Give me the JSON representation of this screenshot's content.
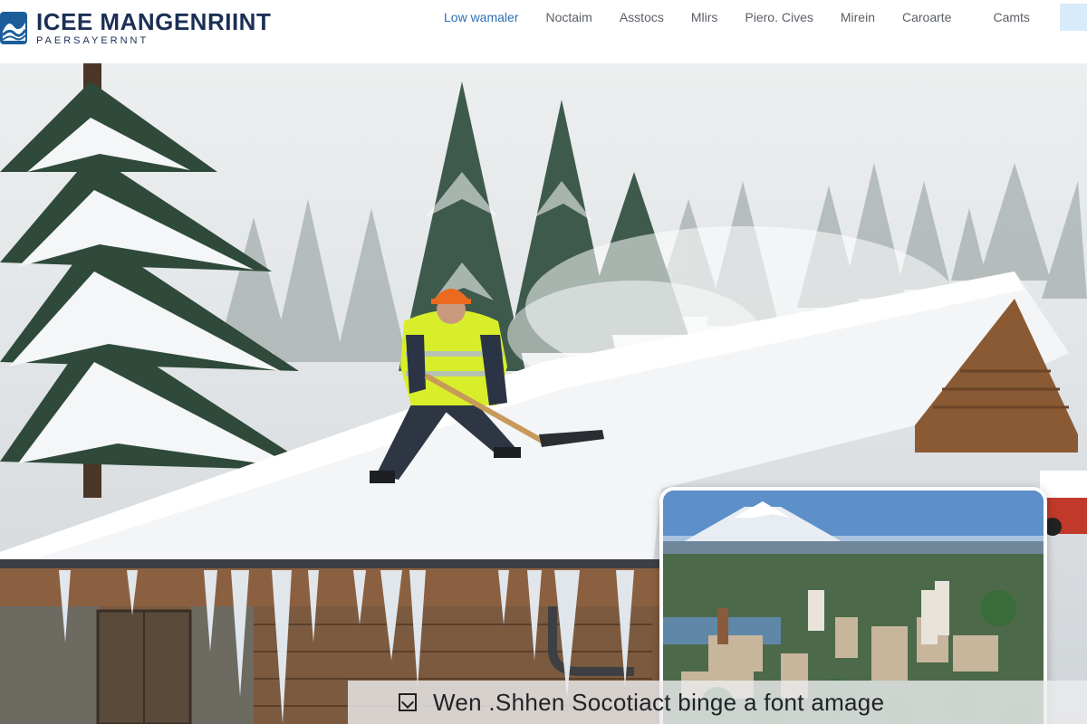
{
  "brand": {
    "title": "ICEE MANGENRIINT",
    "subtitle": "PAERSAYERNNT",
    "accent_color": "#1b2f55",
    "logo_icon": "wave-mountain-logo-icon"
  },
  "nav": {
    "items": [
      {
        "label": "Low wamaler",
        "active": true
      },
      {
        "label": "Noctaim",
        "active": false
      },
      {
        "label": "Asstocs",
        "active": false
      },
      {
        "label": "Mlirs",
        "active": false
      },
      {
        "label": "Piero. Cives",
        "active": false
      },
      {
        "label": "Mirein",
        "active": false
      },
      {
        "label": "Caroarte",
        "active": false
      },
      {
        "label": "Camts",
        "active": false
      }
    ],
    "active_color": "#2f6fb5"
  },
  "hero": {
    "scene": "worker-raking-snow-off-roof-photo",
    "inset_scene": "city-skyline-with-mountain-photo"
  },
  "caption": {
    "icon": "image-icon",
    "text": "Wen .Shhen Socotiact binge a font amage"
  }
}
